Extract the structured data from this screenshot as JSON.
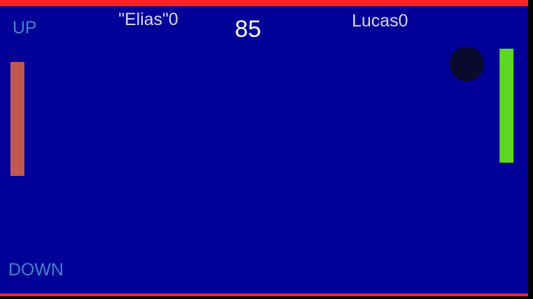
{
  "controls": {
    "up_label": "UP",
    "down_label": "DOWN"
  },
  "players": {
    "left_label": "\"Elias\"0",
    "right_label": "Lucas0"
  },
  "timer": "85",
  "colors": {
    "field": "#000099",
    "walls": "#ff2222",
    "left_paddle": "#c0584e",
    "right_paddle": "#5dd723",
    "ball": "#0a0a2e",
    "controls_text": "#3f86c6"
  }
}
